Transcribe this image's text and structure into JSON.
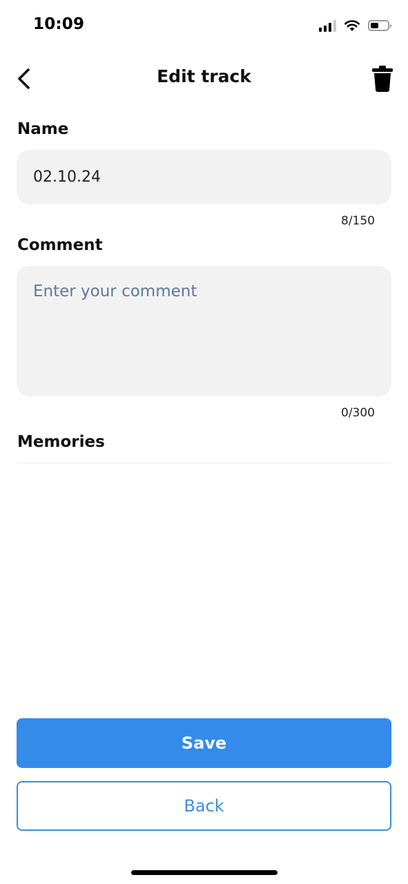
{
  "status_bar": {
    "time": "10:09",
    "icons": [
      "cellular-signal-icon",
      "wifi-icon",
      "battery-icon"
    ]
  },
  "header": {
    "title": "Edit track",
    "back_icon": "chevron-left-icon",
    "delete_icon": "trash-icon"
  },
  "form": {
    "name": {
      "label": "Name",
      "value": "02.10.24",
      "counter": "8/150"
    },
    "comment": {
      "label": "Comment",
      "value": "",
      "placeholder": "Enter your comment",
      "counter": "0/300"
    },
    "memories": {
      "label": "Memories"
    }
  },
  "actions": {
    "save_label": "Save",
    "back_label": "Back"
  },
  "colors": {
    "primary": "#348bea",
    "secondary_text": "#3b8fe0",
    "field_background": "#f2f2f2",
    "placeholder": "#5c7a9b"
  }
}
